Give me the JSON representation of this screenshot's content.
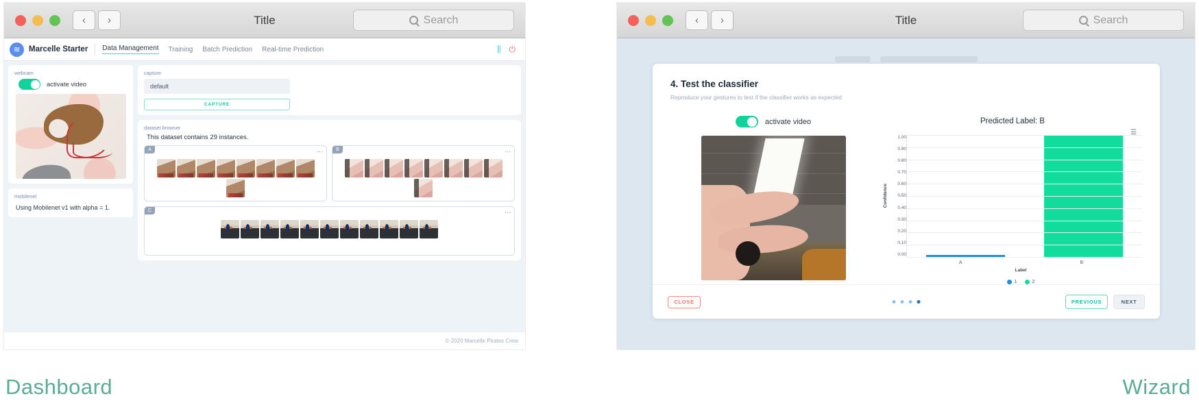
{
  "dashboard": {
    "window": {
      "title": "Title",
      "search_placeholder": "Search",
      "nav_back": "‹",
      "nav_forward": "›"
    },
    "menubar": {
      "brand": "Marcelle Starter",
      "logo_glyph": "≋",
      "items": [
        {
          "label": "Data Management",
          "active": true
        },
        {
          "label": "Training",
          "active": false
        },
        {
          "label": "Batch Prediction",
          "active": false
        },
        {
          "label": "Real-time Prediction",
          "active": false
        }
      ],
      "settings_icon": "⫼",
      "power_icon": "⏻"
    },
    "webcam_card": {
      "label": "webcam",
      "toggle_label": "activate video",
      "toggle_on": true
    },
    "mobilenet_card": {
      "label": "mobilenet",
      "text": "Using Mobilenet v1 with alpha = 1."
    },
    "capture_card": {
      "label": "capture",
      "input_value": "default",
      "button_label": "CAPTURE"
    },
    "dataset_browser": {
      "label": "dataset browser",
      "count_text": "This dataset contains 29 instances.",
      "classes": [
        {
          "name": "A",
          "thumb_count": 9,
          "kind": "a"
        },
        {
          "name": "B",
          "thumb_count": 9,
          "kind": "b"
        },
        {
          "name": "C",
          "thumb_count": 11,
          "kind": "c"
        }
      ],
      "menu_icon": "⋮"
    },
    "footer": "© 2020 Marcelle Pirates Crew",
    "caption": "Dashboard"
  },
  "wizard": {
    "window": {
      "title": "Title",
      "search_placeholder": "Search",
      "nav_back": "‹",
      "nav_forward": "›"
    },
    "step": {
      "title": "4. Test the classifier",
      "subtitle": "Reproduce your gestures to test if the classifier works as expected"
    },
    "video": {
      "toggle_label": "activate video",
      "toggle_on": true
    },
    "chart_menu_icon": "☰",
    "footer": {
      "close_label": "CLOSE",
      "previous_label": "PREVIOUS",
      "next_label": "NEXT",
      "page_dots": 4,
      "active_dot": 4
    },
    "caption": "Wizard"
  },
  "chart_data": {
    "type": "bar",
    "title": "Predicted Label: B",
    "categories": [
      "A",
      "B"
    ],
    "values": [
      0.01,
      1.0
    ],
    "colors": [
      "#1a8fe3",
      "#12dc9b"
    ],
    "xlabel": "Label",
    "ylabel": "Confidence",
    "ylim": [
      0,
      1
    ],
    "yticks": [
      "1.00",
      "0.90",
      "0.80",
      "0.70",
      "0.60",
      "0.50",
      "0.40",
      "0.30",
      "0.20",
      "0.10",
      "0.00"
    ],
    "legend": [
      {
        "label": "1",
        "color": "#1a8fe3"
      },
      {
        "label": "2",
        "color": "#12dc9b"
      }
    ],
    "legend_position": "bottom",
    "grid": true
  },
  "colors": {
    "accent_teal": "#16c1a8",
    "accent_green": "#0fd39a",
    "danger_red": "#f06c65",
    "brand_blue": "#5b8def",
    "caption_green": "#5cab94"
  }
}
